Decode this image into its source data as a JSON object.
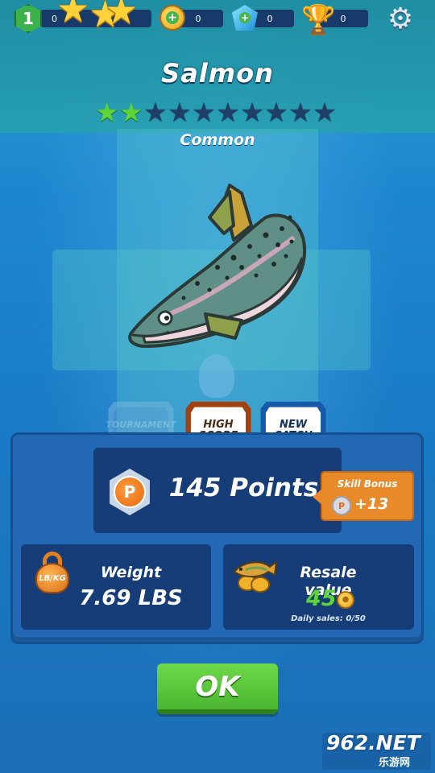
{
  "topbar": {
    "level": "1",
    "xp_value": "0",
    "coins": "0",
    "gems": "0",
    "trophies": "0",
    "icons": [
      "level-badge",
      "star-icon",
      "coin-add-icon",
      "gem-add-icon",
      "trophy-icon",
      "gear-icon"
    ]
  },
  "fish": {
    "name": "Salmon",
    "stars_filled": 2,
    "stars_total": 10,
    "rarity": "Common"
  },
  "badges": {
    "tournament": "TOURNAMENT CATCH",
    "high_score": "HIGH SCORE",
    "new_catch": "NEW CATCH"
  },
  "points": {
    "icon_letter": "P",
    "text": "145 Points"
  },
  "skill_bonus": {
    "title": "Skill Bonus",
    "icon_letter": "P",
    "value": "+13"
  },
  "weight": {
    "icon_text": "LB/KG",
    "title": "Weight",
    "value": "7.69 LBS"
  },
  "resale": {
    "title": "Resale value",
    "value": "45",
    "daily_sales": "Daily sales: 0/50"
  },
  "ok_label": "OK",
  "watermark": {
    "main": "962.NET",
    "sub": "乐游网"
  },
  "colors": {
    "accent_green": "#5fd43a",
    "skill_orange": "#e98a2a",
    "panel_blue": "#2368b5"
  }
}
